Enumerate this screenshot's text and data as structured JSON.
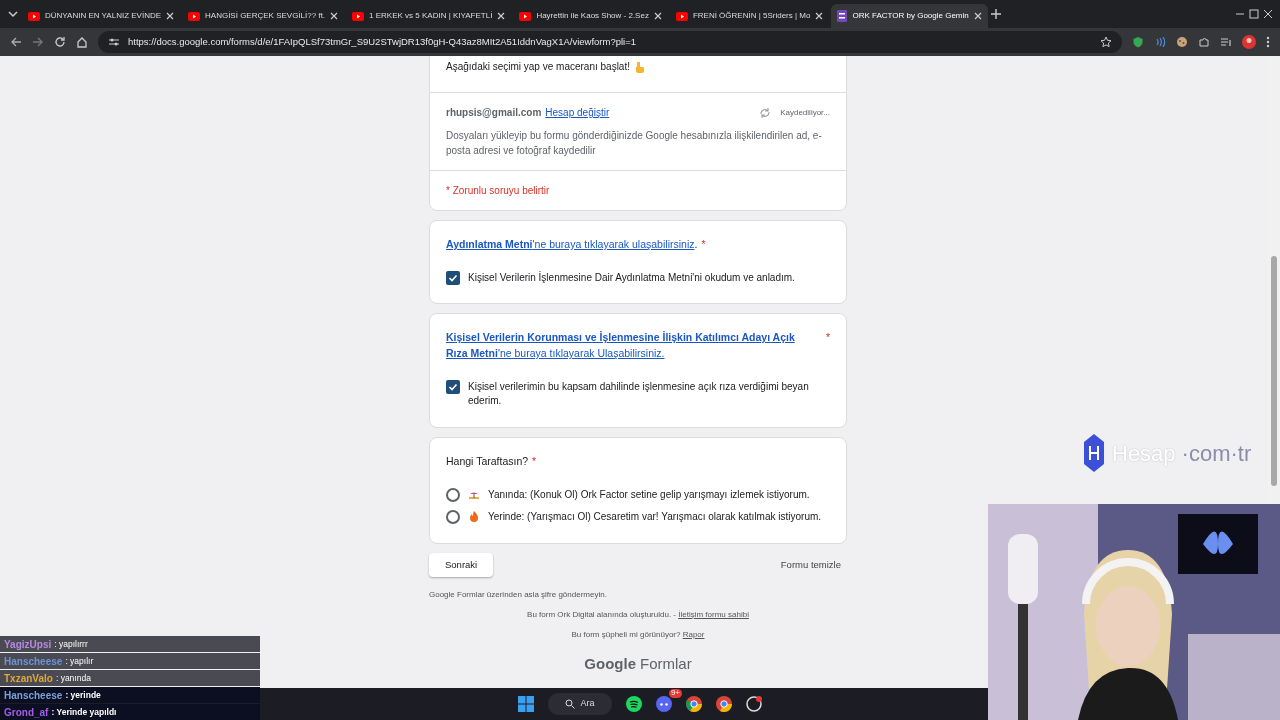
{
  "browser": {
    "tabs": [
      {
        "title": "DÜNYANIN EN YALNIZ EVİNDE",
        "selected": false
      },
      {
        "title": "HANGİSİ GERÇEK SEVGİLİ?? ft.",
        "selected": false
      },
      {
        "title": "1 ERKEK vs 5 KADIN | KIYAFETLİ",
        "selected": false
      },
      {
        "title": "Hayrettin ile Kaos Show - 2.Sez",
        "selected": false
      },
      {
        "title": "FRENİ ÖĞRENİN | 5Sriders | Mo",
        "selected": false
      },
      {
        "title": "ORK FACTOR by Google Gemin",
        "selected": true
      }
    ],
    "url": "https://docs.google.com/forms/d/e/1FAIpQLSf73tmGr_S9U2STwjDR13f0gH-Q43az8MIt2A51IddnVagX1A/viewform?pli=1"
  },
  "form": {
    "intro": "Aşağıdaki seçimi yap ve maceranı başlat!",
    "email": "rhupsis@gmail.com",
    "switch_account": "Hesap değiştir",
    "saving": "Kaydediliyor...",
    "notice": "Dosyaları yükleyip bu formu gönderdiğinizde Google hesabınızla ilişkilendirilen ad, e-posta adresi ve fotoğraf kaydedilir",
    "required_note": "* Zorunlu soruyu belirtir",
    "questions": [
      {
        "kind": "checkbox",
        "title_link": "**Aydınlatma Metni**'ne buraya tıklayarak ulaşabilirsiniz",
        "title_tail": ".",
        "required_mark": "*",
        "options": [
          {
            "label": "Kişisel Verilerin İşlenmesine Dair Aydınlatma Metni'ni okudum ve anladım.",
            "checked": true
          }
        ]
      },
      {
        "kind": "checkbox",
        "title_link": "**Kişisel Verilerin Korunması ve İşlenmesine İlişkin Katılımcı Adayı Açık Rıza Metni**'ne buraya tıklayarak Ulaşabilirsiniz.",
        "required_mark": "*",
        "options": [
          {
            "label": "Kişisel verilerimin bu kapsam dahilinde işlenmesine açık rıza verdiğimi beyan ederim.",
            "checked": true
          }
        ]
      },
      {
        "kind": "radio",
        "title": "Hangi Taraftasın?",
        "required_mark": "*",
        "options": [
          {
            "label": "Yanında: (Konuk Ol) Ork Factor setine gelip yarışmayı izlemek istiyorum.",
            "selected": false
          },
          {
            "label": "Yerinde: (Yarışmacı Ol) Cesaretim var! Yarışmacı olarak katılmak istiyorum.",
            "selected": false
          }
        ]
      }
    ],
    "next_button": "Sonraki",
    "clear_button": "Formu temizle",
    "footer": {
      "warning": "Google Formlar üzerinden asla şifre göndermeyin.",
      "created": "Bu form Ork Digital alanında oluşturuldu. - ",
      "contact_link": "İletişim formu sahibi",
      "suspicious": "Bu form şüpheli mi görünüyor? ",
      "report_link": "Rapor",
      "logo_google": "Google",
      "logo_forms": "Formlar"
    }
  },
  "overlay_logo": {
    "name": "Hesap",
    "dot_com": "·com·tr"
  },
  "chat": [
    {
      "kind": "old",
      "user": "YagizUpsi",
      "color": "#b58ae0",
      "message": ": yapılırrr"
    },
    {
      "kind": "old",
      "user": "Hanscheese",
      "color": "#6b93d6",
      "message": ": yapılır"
    },
    {
      "kind": "old",
      "user": "TxzanValo",
      "color": "#e0a63a",
      "message": ": yanında"
    },
    {
      "kind": "new",
      "user": "Hanscheese",
      "color": "#7aa0d8",
      "message": ": yerinde"
    },
    {
      "kind": "new",
      "user": "Grond_af",
      "color": "#a35ee6",
      "message": ": Yerinde yapıldı"
    }
  ],
  "taskbar": {
    "search": "Ara",
    "discord_badge": "9+"
  }
}
